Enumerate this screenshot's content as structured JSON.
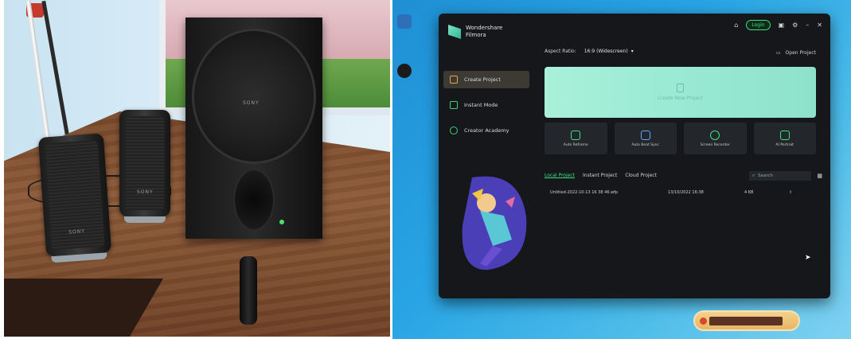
{
  "left_photo": {
    "brand_text": "SONY"
  },
  "app": {
    "logo_line1": "Wondershare",
    "logo_line2": "Filmora",
    "login_label": "Login",
    "aspect_ratio_label": "Aspect Ratio:",
    "aspect_ratio_value": "16:9 (Widescreen)",
    "open_project_label": "Open Project",
    "new_project_label": "Create New Project",
    "sidebar": [
      {
        "label": "Create Project"
      },
      {
        "label": "Instant Mode"
      },
      {
        "label": "Creator Academy"
      }
    ],
    "tools": [
      {
        "label": "Auto Reframe"
      },
      {
        "label": "Auto Beat Sync"
      },
      {
        "label": "Screen Recorder"
      },
      {
        "label": "AI Portrait"
      }
    ],
    "tabs": [
      {
        "label": "Local Project"
      },
      {
        "label": "Instant Project"
      },
      {
        "label": "Cloud Project"
      }
    ],
    "search_placeholder": "Search",
    "files": [
      {
        "name": "Untitled-2022-10-13 16 38 46.wfp",
        "date": "13/10/2022 16:38",
        "size": "4 KB"
      }
    ],
    "accent_color": "#3ee07d"
  }
}
